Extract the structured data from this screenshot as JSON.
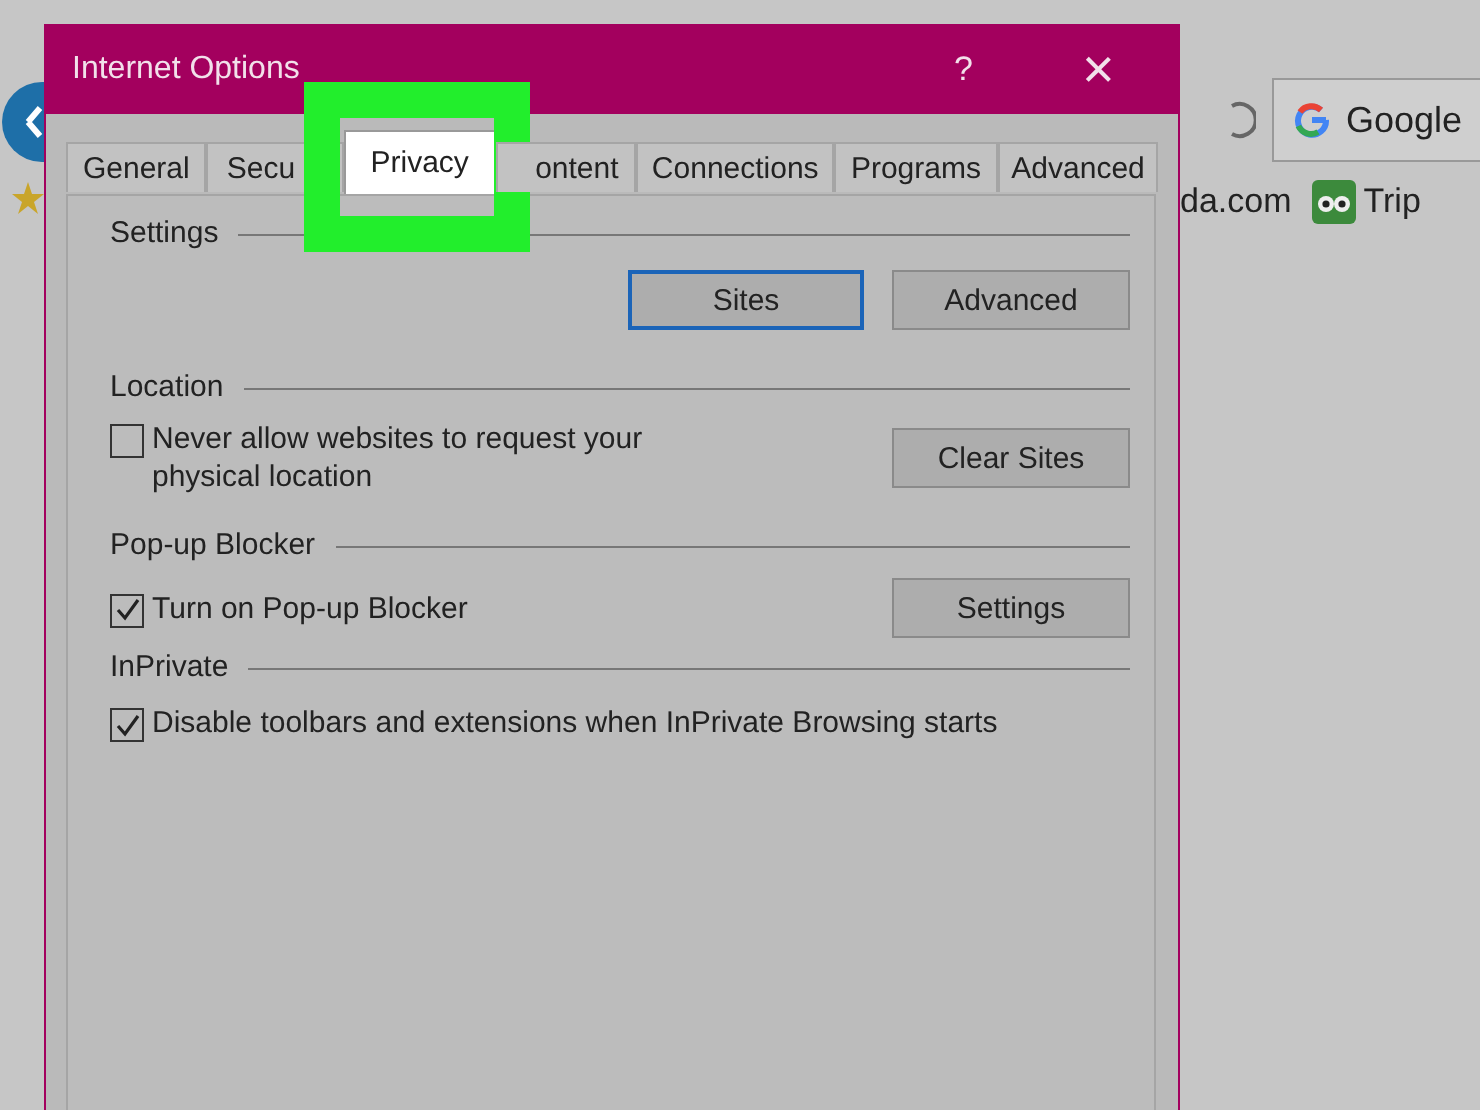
{
  "browser": {
    "search_box": {
      "label": "Google"
    },
    "bookmarks": [
      {
        "label": "da.com",
        "kind": "text"
      },
      {
        "label": "Trip",
        "kind": "icon"
      }
    ]
  },
  "window": {
    "title": "Internet Options",
    "help": "?",
    "close": "×"
  },
  "tabs": [
    {
      "label": "General",
      "selected": false,
      "highlighted": false
    },
    {
      "label": "Secu",
      "selected": false,
      "highlighted": false
    },
    {
      "label": "Privacy",
      "selected": true,
      "highlighted": true
    },
    {
      "label": "ontent",
      "selected": false,
      "highlighted": false
    },
    {
      "label": "Connections",
      "selected": false,
      "highlighted": false
    },
    {
      "label": "Programs",
      "selected": false,
      "highlighted": false
    },
    {
      "label": "Advanced",
      "selected": false,
      "highlighted": false
    }
  ],
  "sections": [
    {
      "title": "Settings",
      "buttons": [
        {
          "label": "Sites",
          "focused": true
        },
        {
          "label": "Advanced",
          "focused": false
        }
      ]
    },
    {
      "title": "Location",
      "option": {
        "label": "Never allow websites to request your physical location",
        "checked": false
      },
      "buttons": [
        {
          "label": "Clear Sites",
          "focused": false
        }
      ]
    },
    {
      "title": "Pop-up Blocker",
      "option": {
        "label": "Turn on Pop-up Blocker",
        "checked": true
      },
      "buttons": [
        {
          "label": "Settings",
          "focused": false
        }
      ]
    },
    {
      "title": "InPrivate",
      "option": {
        "label": "Disable toolbars and extensions when InPrivate Browsing starts",
        "checked": true
      }
    }
  ]
}
